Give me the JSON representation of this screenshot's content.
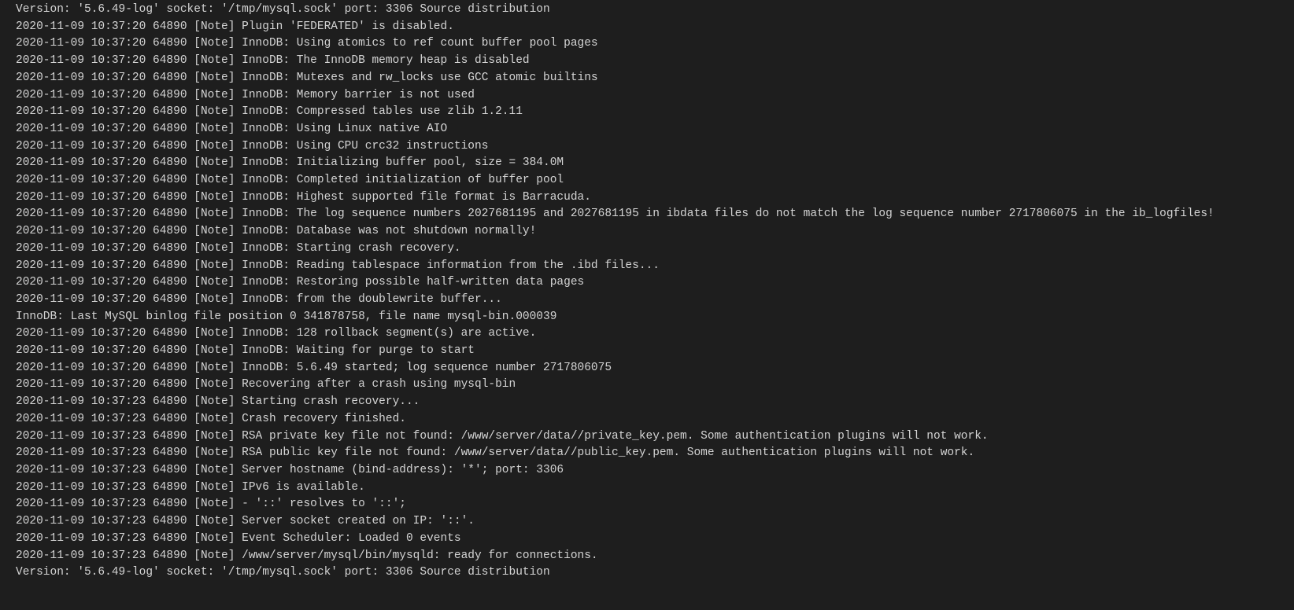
{
  "lines": [
    "Version: '5.6.49-log'  socket: '/tmp/mysql.sock'  port: 3306  Source distribution",
    "2020-11-09 10:37:20 64890 [Note] Plugin 'FEDERATED' is disabled.",
    "2020-11-09 10:37:20 64890 [Note] InnoDB: Using atomics to ref count buffer pool pages",
    "2020-11-09 10:37:20 64890 [Note] InnoDB: The InnoDB memory heap is disabled",
    "2020-11-09 10:37:20 64890 [Note] InnoDB: Mutexes and rw_locks use GCC atomic builtins",
    "2020-11-09 10:37:20 64890 [Note] InnoDB: Memory barrier is not used",
    "2020-11-09 10:37:20 64890 [Note] InnoDB: Compressed tables use zlib 1.2.11",
    "2020-11-09 10:37:20 64890 [Note] InnoDB: Using Linux native AIO",
    "2020-11-09 10:37:20 64890 [Note] InnoDB: Using CPU crc32 instructions",
    "2020-11-09 10:37:20 64890 [Note] InnoDB: Initializing buffer pool, size = 384.0M",
    "2020-11-09 10:37:20 64890 [Note] InnoDB: Completed initialization of buffer pool",
    "2020-11-09 10:37:20 64890 [Note] InnoDB: Highest supported file format is Barracuda.",
    "2020-11-09 10:37:20 64890 [Note] InnoDB: The log sequence numbers 2027681195 and 2027681195 in ibdata files do not match the log sequence number 2717806075 in the ib_logfiles!",
    "2020-11-09 10:37:20 64890 [Note] InnoDB: Database was not shutdown normally!",
    "2020-11-09 10:37:20 64890 [Note] InnoDB: Starting crash recovery.",
    "2020-11-09 10:37:20 64890 [Note] InnoDB: Reading tablespace information from the .ibd files...",
    "2020-11-09 10:37:20 64890 [Note] InnoDB: Restoring possible half-written data pages ",
    "2020-11-09 10:37:20 64890 [Note] InnoDB: from the doublewrite buffer...",
    "InnoDB: Last MySQL binlog file position 0 341878758, file name mysql-bin.000039",
    "2020-11-09 10:37:20 64890 [Note] InnoDB: 128 rollback segment(s) are active.",
    "2020-11-09 10:37:20 64890 [Note] InnoDB: Waiting for purge to start",
    "2020-11-09 10:37:20 64890 [Note] InnoDB: 5.6.49 started; log sequence number 2717806075",
    "2020-11-09 10:37:20 64890 [Note] Recovering after a crash using mysql-bin",
    "2020-11-09 10:37:23 64890 [Note] Starting crash recovery...",
    "2020-11-09 10:37:23 64890 [Note] Crash recovery finished.",
    "2020-11-09 10:37:23 64890 [Note] RSA private key file not found: /www/server/data//private_key.pem. Some authentication plugins will not work.",
    "2020-11-09 10:37:23 64890 [Note] RSA public key file not found: /www/server/data//public_key.pem. Some authentication plugins will not work.",
    "2020-11-09 10:37:23 64890 [Note] Server hostname (bind-address): '*'; port: 3306",
    "2020-11-09 10:37:23 64890 [Note] IPv6 is available.",
    "2020-11-09 10:37:23 64890 [Note]   - '::' resolves to '::';",
    "2020-11-09 10:37:23 64890 [Note] Server socket created on IP: '::'.",
    "2020-11-09 10:37:23 64890 [Note] Event Scheduler: Loaded 0 events",
    "2020-11-09 10:37:23 64890 [Note] /www/server/mysql/bin/mysqld: ready for connections.",
    "Version: '5.6.49-log'  socket: '/tmp/mysql.sock'  port: 3306  Source distribution"
  ]
}
